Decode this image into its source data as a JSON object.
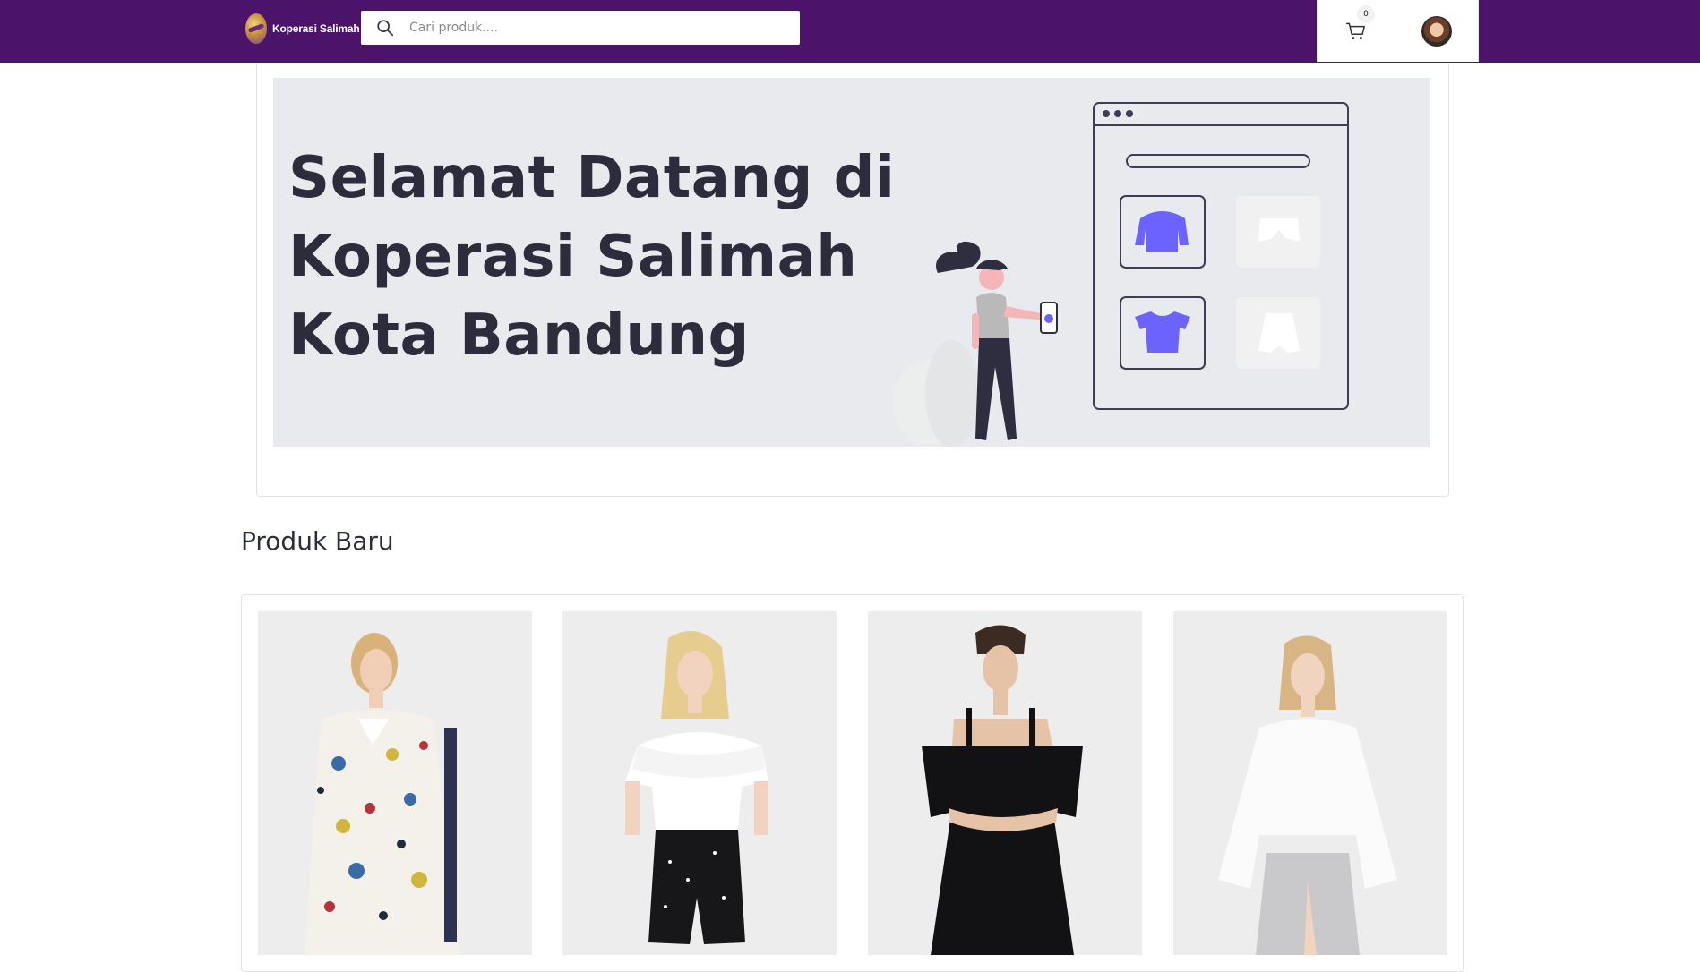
{
  "header": {
    "brand_name": "Koperasi Salimah",
    "search_placeholder": "Cari produk....",
    "cart_count": "0",
    "brand_color": "#4b146a"
  },
  "hero": {
    "title_lines": [
      "Selamat Datang di",
      "Koperasi Salimah",
      "Kota Bandung"
    ],
    "accent_color": "#6c63ff"
  },
  "sections": {
    "new_products_title": "Produk Baru"
  },
  "products": [
    {
      "image": "woman-floral-blazer"
    },
    {
      "image": "woman-white-ruffle-top-black-shorts"
    },
    {
      "image": "woman-black-cold-shoulder-dress"
    },
    {
      "image": "woman-white-blouse-grey-skirt"
    }
  ],
  "icons": {
    "search": "search-icon",
    "cart": "cart-icon",
    "profile": "avatar"
  }
}
